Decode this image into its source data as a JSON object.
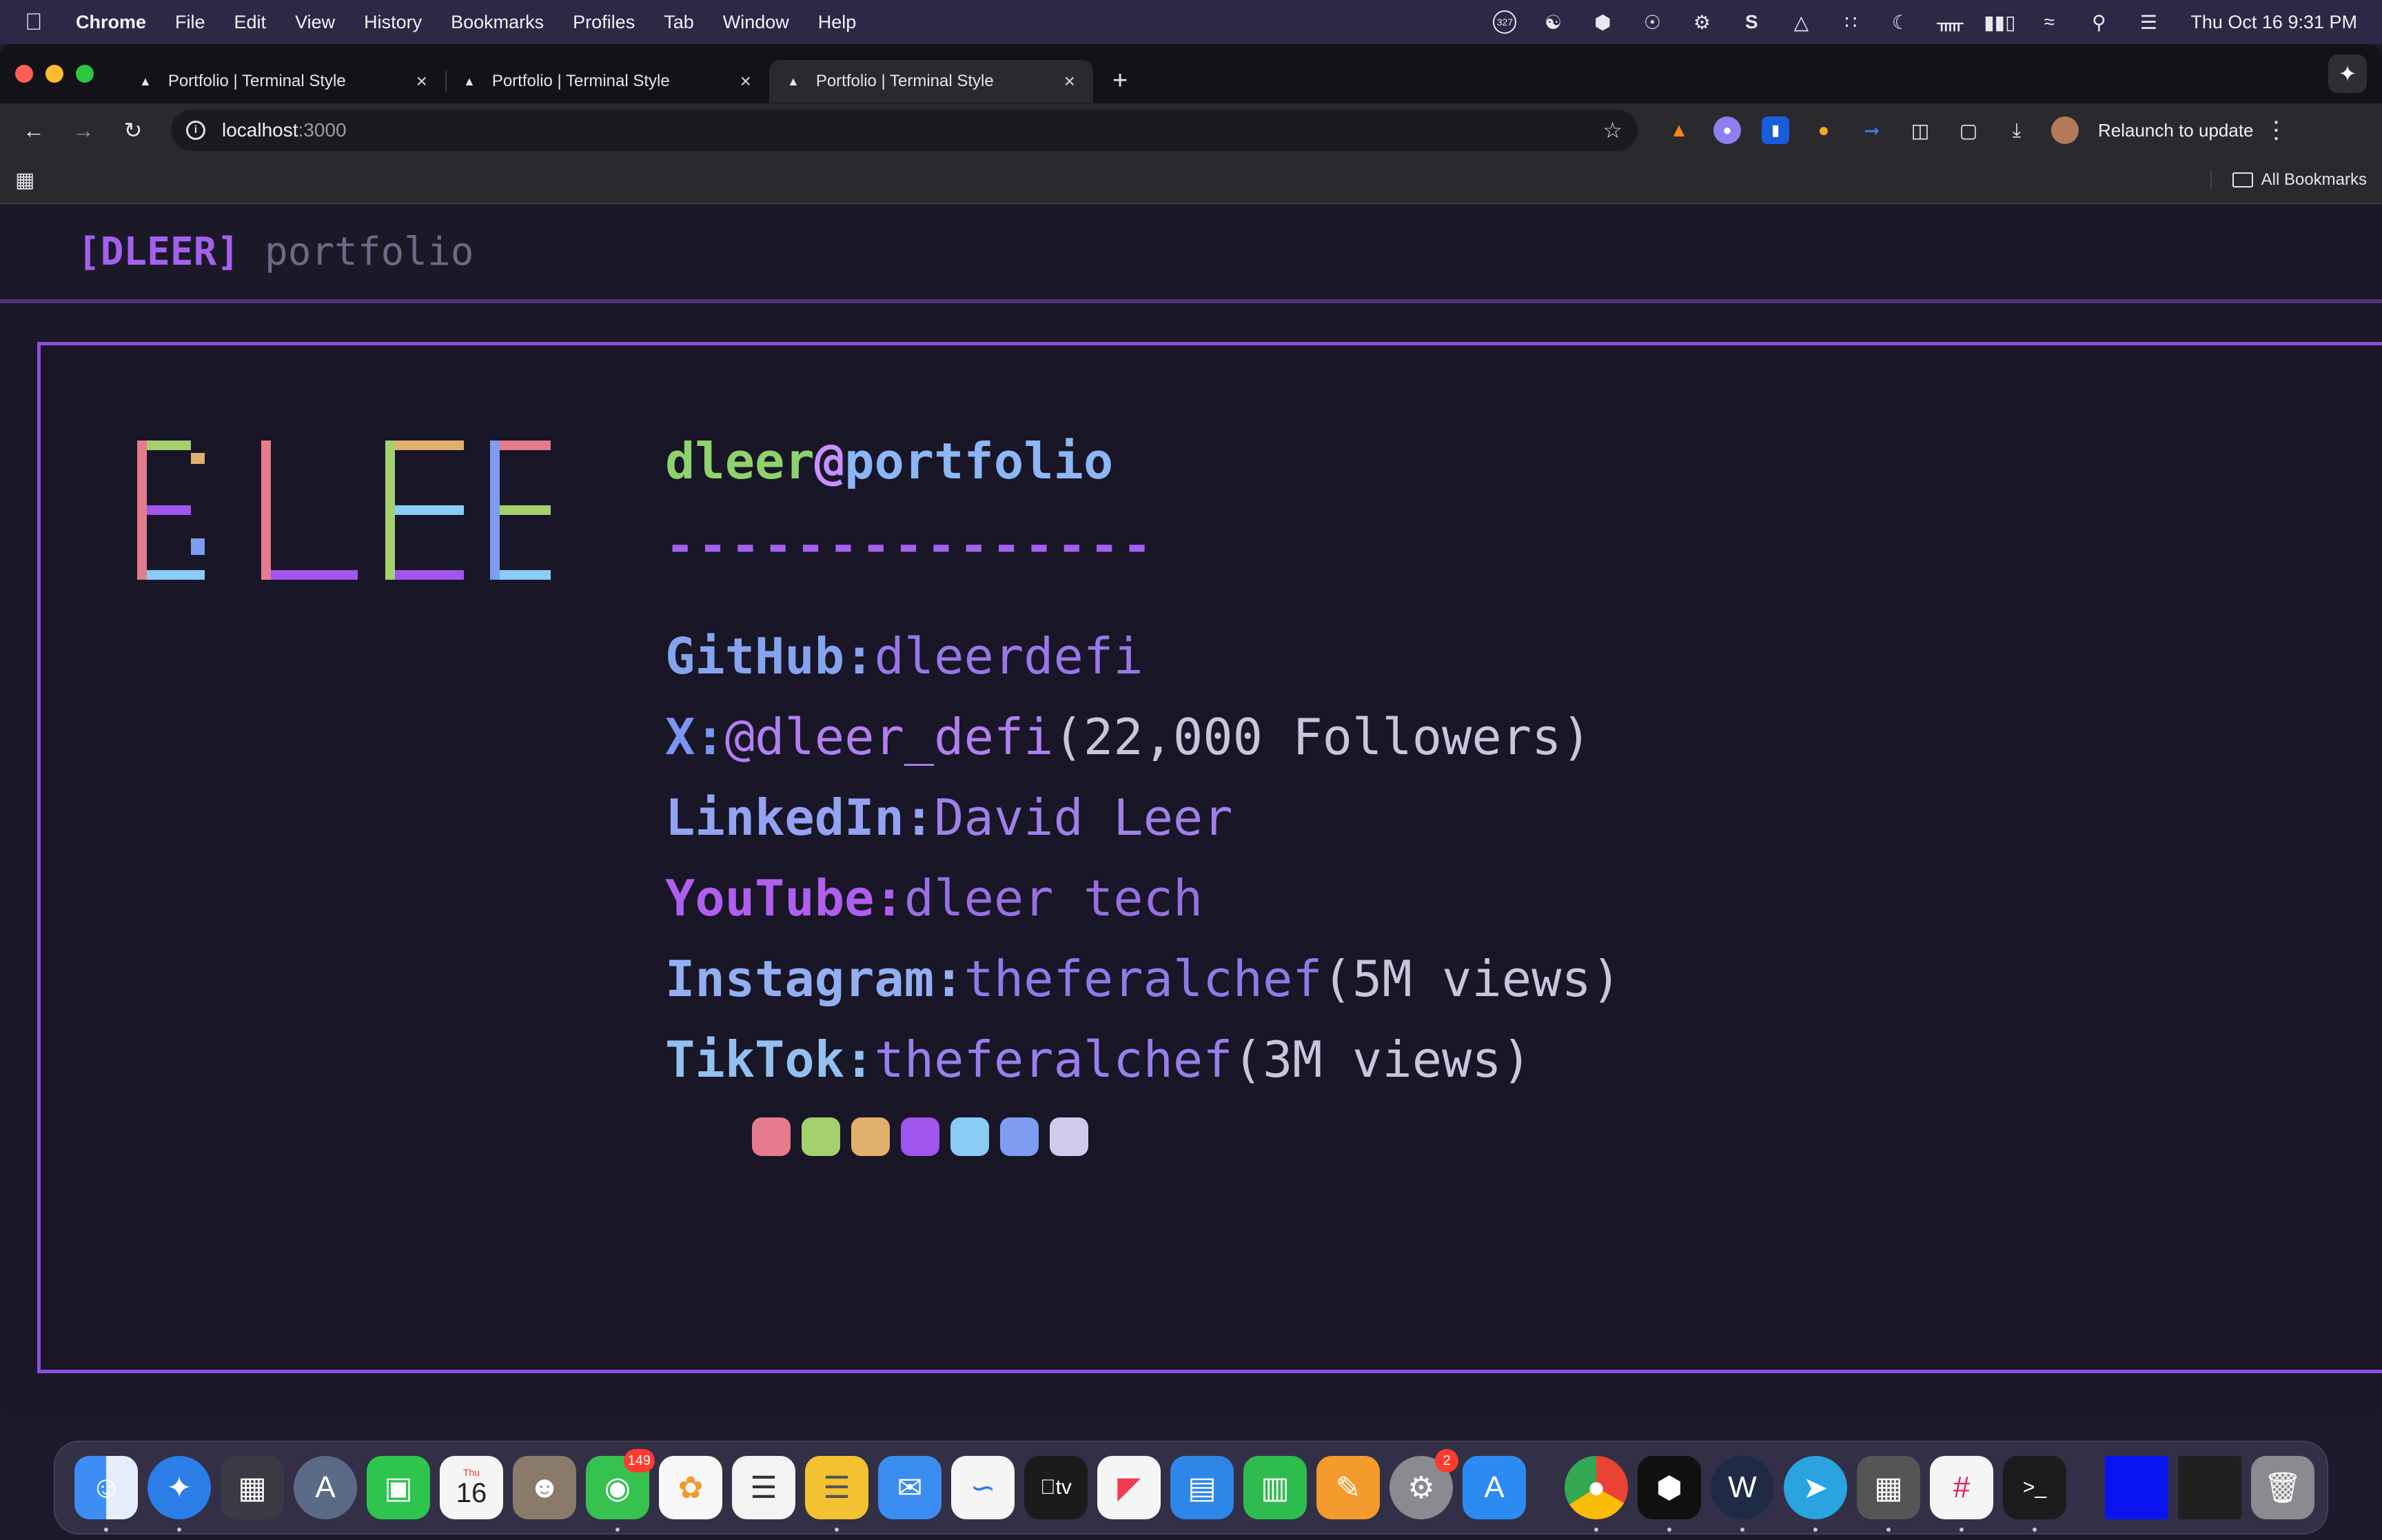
{
  "menubar": {
    "app_name": "Chrome",
    "items": [
      "File",
      "Edit",
      "View",
      "History",
      "Bookmarks",
      "Profiles",
      "Tab",
      "Window",
      "Help"
    ],
    "clock": "Thu Oct 16  9:31 PM",
    "tray_badge": "327"
  },
  "browser": {
    "tabs": [
      {
        "title": "Portfolio | Terminal Style",
        "active": false
      },
      {
        "title": "Portfolio | Terminal Style",
        "active": false
      },
      {
        "title": "Portfolio | Terminal Style",
        "active": true
      }
    ],
    "url_host": "localhost",
    "url_port": ":3000",
    "relaunch_label": "Relaunch to update",
    "all_bookmarks_label": "All Bookmarks"
  },
  "page": {
    "brand": "[DLEER]",
    "brand_sub": "portfolio",
    "prompt_user": "dleer",
    "prompt_at": "@",
    "prompt_host": "portfolio",
    "dashes": "---------------",
    "links": [
      {
        "label": "GitHub:",
        "value": "dleerdefi",
        "extra": ""
      },
      {
        "label": "X:",
        "value": "@dleer_defi",
        "extra": "(22,000 Followers)"
      },
      {
        "label": "LinkedIn:",
        "value": "David Leer",
        "extra": ""
      },
      {
        "label": "YouTube:",
        "value": "dleer tech",
        "extra": ""
      },
      {
        "label": "Instagram:",
        "value": "theferalchef",
        "extra": "(5M views)"
      },
      {
        "label": "TikTok:",
        "value": "theferalchef",
        "extra": "(3M views)"
      }
    ],
    "palette": [
      "#e57b8d",
      "#a4d06e",
      "#e0b06c",
      "#9f55ee",
      "#89ccf6",
      "#7d9cf2",
      "#cfcbef"
    ],
    "logo_text": "ELEE"
  },
  "dock": {
    "calendar_day": "16",
    "calendar_month": "Thu",
    "messages_badge": "149",
    "settings_badge": "2"
  }
}
